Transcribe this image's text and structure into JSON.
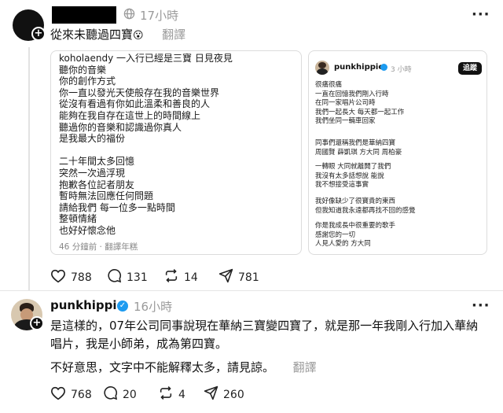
{
  "post1": {
    "time": "17小時",
    "text": "從來未聽過四寶",
    "emoji": "😮",
    "translate_label": "翻譯",
    "left_card": {
      "lines": [
        "koholaendy 一入行已經是三寶 日見夜見",
        "聽你的音樂",
        "你的創作方式",
        "你一直以發光天使般存在我的音樂世界",
        "從沒有看過有你如此溫柔和善良的人",
        "能夠在我自存在這世上的時間線上",
        "聽過你的音樂和認識過你真人",
        "是我最大的福份",
        "",
        "二十年間太多回憶",
        "突然一次過浮現",
        "抱歉各位記者朋友",
        "暫時無法回應任何問題",
        "請給我們 每一位多一點時間",
        "整頓情緒",
        "也好好懷念他"
      ],
      "footer": "46 分鐘前 · 翻譯年糕"
    },
    "right_card": {
      "username": "punkhippie",
      "time": "3 小時",
      "follow_label": "追蹤",
      "paragraphs": [
        "很痛很痛\n一直在回憶我們剛入行時\n在同一家唱片公司時\n我們一起長大 每天都一起工作\n我們坐同一輛車回家",
        "同事們還稱我們是華納四寶\n周國賢 薛凱琪 方大同 周柏豪",
        "一轉眼 大同就離開了我們\n我沒有太多話想說 能說\n我不想接受這事實",
        "我好像缺少了很寶貴的東西\n但我知道我永遠都再找不回的感覺",
        "你是我成長中很重要的歌手\n感謝您的一切\n人見人愛的 方大同"
      ]
    },
    "stats": {
      "likes": "788",
      "comments": "131",
      "reposts": "14",
      "shares": "781"
    }
  },
  "post2": {
    "username": "punkhippie",
    "time": "16小時",
    "text_line1": "是這樣的，07年公司同事說現在華納三寶變四寶了，就是那一年我剛入行加入華納",
    "text_line2": "唱片，我是小師弟，成為第四寶。",
    "text_line3": "不好意思，文字中不能解釋太多，請見諒。",
    "translate_label": "翻譯",
    "stats": {
      "likes": "768",
      "comments": "20",
      "reposts": "4",
      "shares": "260"
    }
  },
  "colors": {
    "verified": "#1d9bf0",
    "muted": "#9a9a9a",
    "border": "#dcdcdc"
  },
  "icons": [
    "globe-icon",
    "more-icon",
    "heart-icon",
    "comment-icon",
    "repost-icon",
    "share-icon",
    "verified-icon",
    "plus-icon"
  ]
}
